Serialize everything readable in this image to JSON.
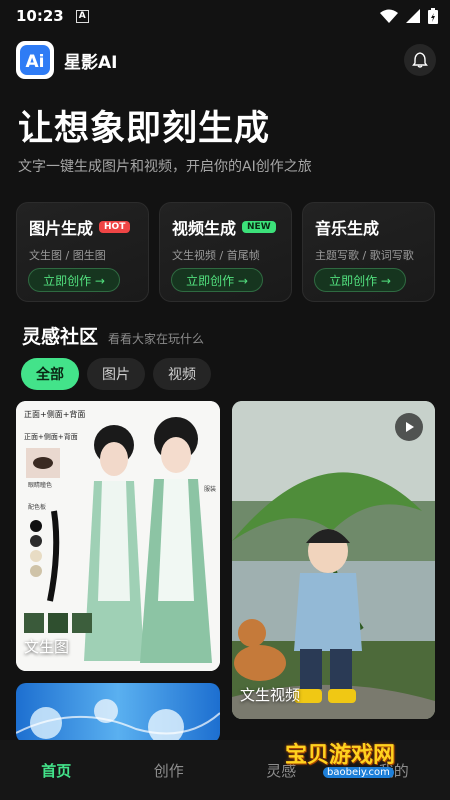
{
  "status": {
    "time": "10:23",
    "notify_glyph": "A"
  },
  "app": {
    "name": "星影AI",
    "logo_text": "Ai"
  },
  "hero": {
    "title": "让想象即刻生成",
    "subtitle": "文字一键生成图片和视频，开启你的AI创作之旅"
  },
  "features": [
    {
      "title": "图片生成",
      "badge": "HOT",
      "sub": "文生图 / 图生图",
      "button": "立即创作 →"
    },
    {
      "title": "视频生成",
      "badge": "NEW",
      "sub": "文生视频 / 首尾帧",
      "button": "立即创作 →"
    },
    {
      "title": "音乐生成",
      "badge": "",
      "sub": "主题写歌 / 歌词写歌",
      "button": "立即创作 →"
    }
  ],
  "community": {
    "title": "灵感社区",
    "subtitle": "看看大家在玩什么"
  },
  "filters": [
    {
      "label": "全部",
      "active": true
    },
    {
      "label": "图片"
    },
    {
      "label": "视频"
    }
  ],
  "cards": [
    {
      "label": "文生图",
      "overlay_texts": [
        "正面+侧面+背面",
        "正面+侧面+背面",
        "眼睛瞳色",
        "配色板",
        "服装"
      ]
    },
    {
      "label": "文生视频",
      "has_play": true
    }
  ],
  "tabs": [
    {
      "label": "首页",
      "active": true
    },
    {
      "label": "创作"
    },
    {
      "label": "灵感"
    },
    {
      "label": "我的"
    }
  ],
  "watermark": {
    "text": "宝贝游戏网",
    "url": "baobeiy.com"
  },
  "colors": {
    "accent": "#43e38a",
    "hot": "#ef4545",
    "background": "#121212"
  },
  "icons": [
    "wifi-icon",
    "signal-icon",
    "battery-icon",
    "bell-icon",
    "play-icon",
    "arrow-right-icon"
  ]
}
